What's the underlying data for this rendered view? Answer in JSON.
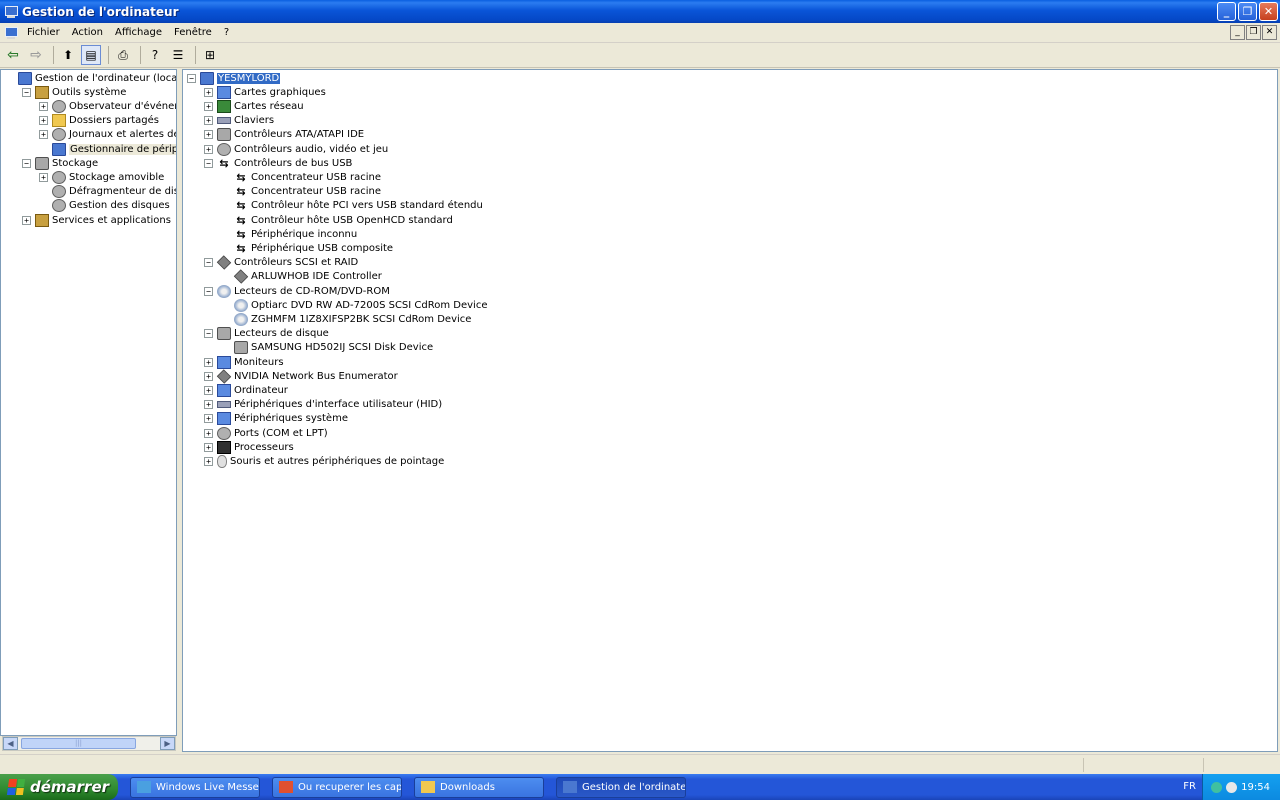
{
  "window": {
    "title": "Gestion de l'ordinateur",
    "min_glyph": "_",
    "max_glyph": "❐",
    "close_glyph": "✕"
  },
  "menu": {
    "items": [
      "Fichier",
      "Action",
      "Affichage",
      "Fenêtre",
      "?"
    ]
  },
  "toolbar": {
    "back": "⇦",
    "forward": "⇨",
    "up": "⬆",
    "tree": "▤",
    "print": "⎙",
    "help": "?",
    "props": "☰",
    "scan": "⊞"
  },
  "left_tree": [
    {
      "label": "Gestion de l'ordinateur (local)",
      "level": 0,
      "exp": "",
      "icon": "computer"
    },
    {
      "label": "Outils système",
      "level": 1,
      "exp": "−",
      "icon": "tools"
    },
    {
      "label": "Observateur d'événements",
      "level": 2,
      "exp": "+",
      "icon": "gear"
    },
    {
      "label": "Dossiers partagés",
      "level": 2,
      "exp": "+",
      "icon": "folder"
    },
    {
      "label": "Journaux et alertes de perfo",
      "level": 2,
      "exp": "+",
      "icon": "gear"
    },
    {
      "label": "Gestionnaire de périphérique",
      "level": 2,
      "exp": "",
      "icon": "computer",
      "selected": true
    },
    {
      "label": "Stockage",
      "level": 1,
      "exp": "−",
      "icon": "disk"
    },
    {
      "label": "Stockage amovible",
      "level": 2,
      "exp": "+",
      "icon": "gear"
    },
    {
      "label": "Défragmenteur de disque",
      "level": 2,
      "exp": "",
      "icon": "gear"
    },
    {
      "label": "Gestion des disques",
      "level": 2,
      "exp": "",
      "icon": "gear"
    },
    {
      "label": "Services et applications",
      "level": 1,
      "exp": "+",
      "icon": "tools"
    }
  ],
  "right_tree": [
    {
      "label": "YESMYLORD",
      "level": 0,
      "exp": "−",
      "icon": "computer",
      "selected": true
    },
    {
      "label": "Cartes graphiques",
      "level": 1,
      "exp": "+",
      "icon": "monitor"
    },
    {
      "label": "Cartes réseau",
      "level": 1,
      "exp": "+",
      "icon": "net"
    },
    {
      "label": "Claviers",
      "level": 1,
      "exp": "+",
      "icon": "kbd"
    },
    {
      "label": "Contrôleurs ATA/ATAPI IDE",
      "level": 1,
      "exp": "+",
      "icon": "disk"
    },
    {
      "label": "Contrôleurs audio, vidéo et jeu",
      "level": 1,
      "exp": "+",
      "icon": "gear"
    },
    {
      "label": "Contrôleurs de bus USB",
      "level": 1,
      "exp": "−",
      "icon": "usb"
    },
    {
      "label": "Concentrateur USB racine",
      "level": 2,
      "exp": "",
      "icon": "usb"
    },
    {
      "label": "Concentrateur USB racine",
      "level": 2,
      "exp": "",
      "icon": "usb"
    },
    {
      "label": "Contrôleur hôte PCI vers USB standard étendu",
      "level": 2,
      "exp": "",
      "icon": "usb"
    },
    {
      "label": "Contrôleur hôte USB OpenHCD standard",
      "level": 2,
      "exp": "",
      "icon": "usb"
    },
    {
      "label": "Périphérique inconnu",
      "level": 2,
      "exp": "",
      "icon": "usb"
    },
    {
      "label": "Périphérique USB composite",
      "level": 2,
      "exp": "",
      "icon": "usb"
    },
    {
      "label": "Contrôleurs SCSI et RAID",
      "level": 1,
      "exp": "−",
      "icon": "diamond"
    },
    {
      "label": "ARLUWHOB IDE Controller",
      "level": 2,
      "exp": "",
      "icon": "diamond"
    },
    {
      "label": "Lecteurs de CD-ROM/DVD-ROM",
      "level": 1,
      "exp": "−",
      "icon": "cd"
    },
    {
      "label": "Optiarc DVD RW AD-7200S SCSI CdRom Device",
      "level": 2,
      "exp": "",
      "icon": "cd"
    },
    {
      "label": "ZGHMFM 1IZ8XIFSP2BK SCSI CdRom Device",
      "level": 2,
      "exp": "",
      "icon": "cd"
    },
    {
      "label": "Lecteurs de disque",
      "level": 1,
      "exp": "−",
      "icon": "disk"
    },
    {
      "label": "SAMSUNG HD502IJ SCSI Disk Device",
      "level": 2,
      "exp": "",
      "icon": "disk"
    },
    {
      "label": "Moniteurs",
      "level": 1,
      "exp": "+",
      "icon": "monitor"
    },
    {
      "label": "NVIDIA Network Bus Enumerator",
      "level": 1,
      "exp": "+",
      "icon": "diamond"
    },
    {
      "label": "Ordinateur",
      "level": 1,
      "exp": "+",
      "icon": "monitor"
    },
    {
      "label": "Périphériques d'interface utilisateur (HID)",
      "level": 1,
      "exp": "+",
      "icon": "kbd"
    },
    {
      "label": "Périphériques système",
      "level": 1,
      "exp": "+",
      "icon": "monitor"
    },
    {
      "label": "Ports (COM et LPT)",
      "level": 1,
      "exp": "+",
      "icon": "gear"
    },
    {
      "label": "Processeurs",
      "level": 1,
      "exp": "+",
      "icon": "chip"
    },
    {
      "label": "Souris et autres périphériques de pointage",
      "level": 1,
      "exp": "+",
      "icon": "mouse"
    }
  ],
  "scrollbar": {
    "left": "◀",
    "right": "▶",
    "grip": "|||"
  },
  "taskbar": {
    "start": "démarrer",
    "tasks": [
      {
        "label": "Windows Live Messen...",
        "color": "#4aa0e0",
        "active": false
      },
      {
        "label": "Ou recuperer les capt...",
        "color": "#e05030",
        "active": false
      },
      {
        "label": "Downloads",
        "color": "#f0c850",
        "active": false
      },
      {
        "label": "Gestion de l'ordinateur",
        "color": "#4a78d0",
        "active": true
      }
    ],
    "lang": "FR",
    "clock": "19:54"
  },
  "colors": {
    "selection": "#316ac5",
    "titlebar": "#0a55d8",
    "taskbar": "#2456d8",
    "start": "#2f8a2f"
  }
}
